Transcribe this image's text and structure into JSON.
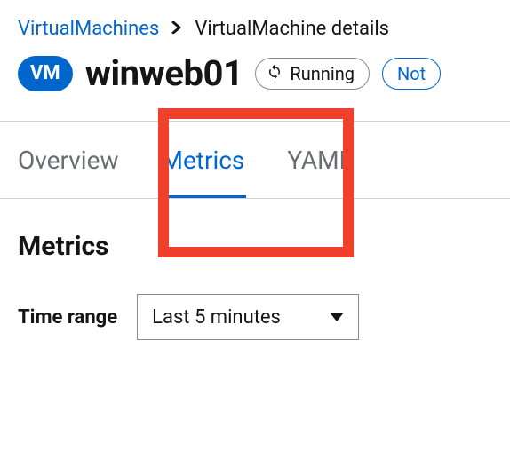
{
  "breadcrumb": {
    "parent": "VirtualMachines",
    "current": "VirtualMachine details"
  },
  "header": {
    "badge": "VM",
    "name": "winweb01",
    "status": "Running",
    "action_partial": "Not"
  },
  "tabs": {
    "overview": "Overview",
    "metrics": "Metrics",
    "yaml": "YAML"
  },
  "section": {
    "title": "Metrics",
    "time_range_label": "Time range",
    "time_range_value": "Last 5 minutes"
  }
}
